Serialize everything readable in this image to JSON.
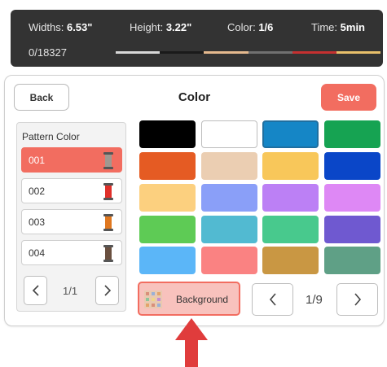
{
  "info_bar": {
    "widths_label": "Widths:",
    "widths_value": "6.53\"",
    "height_label": "Height:",
    "height_value": "3.22\"",
    "color_label": "Color:",
    "color_value": "1/6",
    "time_label": "Time:",
    "time_value": "5min",
    "progress": "0/18327",
    "strip_colors": [
      "#d8d8d8",
      "#1a1a1a",
      "#e5b98e",
      "#707070",
      "#c53030",
      "#e8c06a"
    ]
  },
  "toolbar": {
    "back_label": "Back",
    "title": "Color",
    "save_label": "Save"
  },
  "pattern_panel": {
    "title": "Pattern Color",
    "items": [
      {
        "number": "001",
        "spool_color": "#a09890",
        "selected": true
      },
      {
        "number": "002",
        "spool_color": "#e0302a",
        "selected": false
      },
      {
        "number": "003",
        "spool_color": "#e07820",
        "selected": false
      },
      {
        "number": "004",
        "spool_color": "#6a5040",
        "selected": false
      }
    ],
    "page": "1/1"
  },
  "palette": {
    "colors": [
      "#000000",
      "#ffffff",
      "#1586c6",
      "#16a352",
      "#e55b23",
      "#ebceb2",
      "#f8c75a",
      "#0a46c8",
      "#fcd07f",
      "#8a9ff8",
      "#bc80f5",
      "#de88f5",
      "#5ecb55",
      "#52bad1",
      "#48c98d",
      "#6f59d0",
      "#5bb6f8",
      "#fa8282",
      "#c99743",
      "#5fa086"
    ],
    "selected_index": 2,
    "background_label": "Background",
    "page": "1/9"
  },
  "accent_color": "#f26d60"
}
